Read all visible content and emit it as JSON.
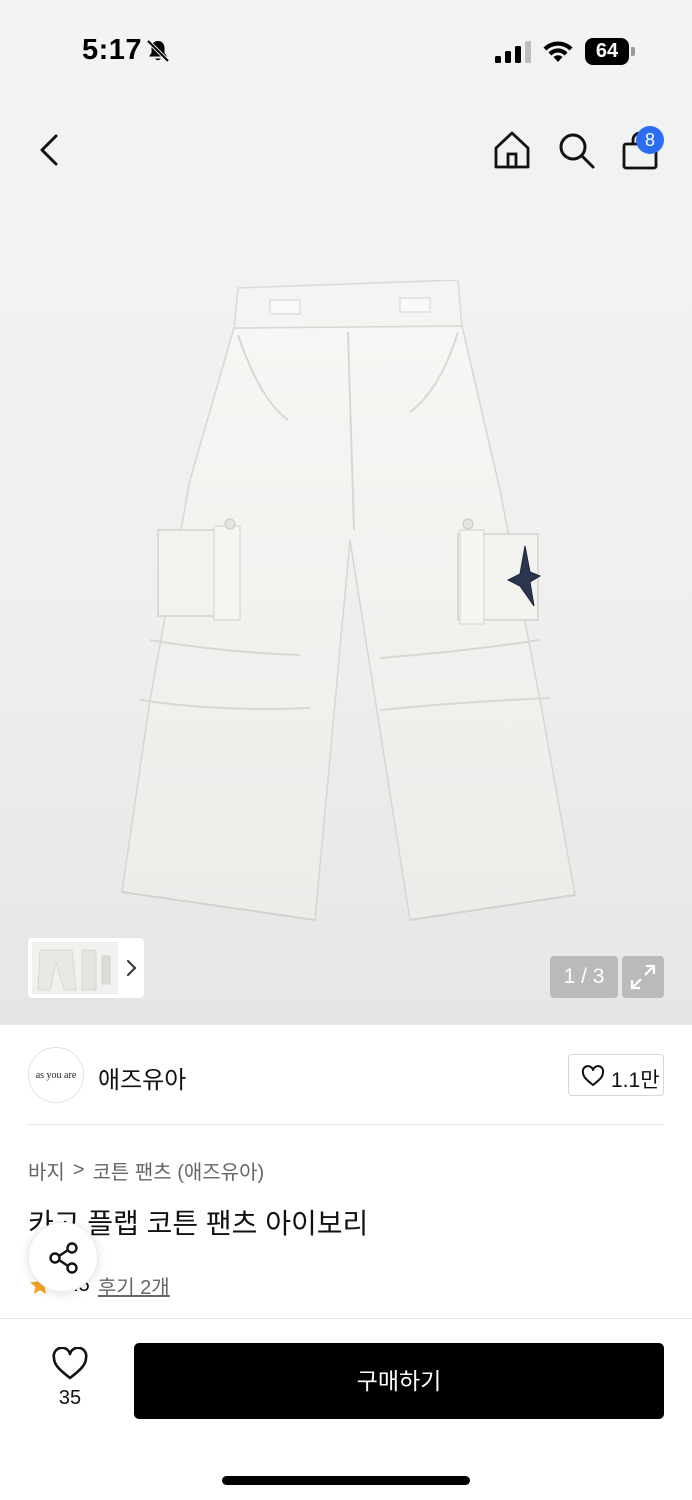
{
  "status_bar": {
    "time": "5:17",
    "battery": "64"
  },
  "nav": {
    "cart_count": "8"
  },
  "gallery": {
    "page_indicator": "1 / 3"
  },
  "brand": {
    "logo_text": "as you are",
    "name": "애즈유아",
    "like_count": "1.1만"
  },
  "breadcrumb": {
    "category": "바지",
    "separator": ">",
    "subcategory": "코튼 팬츠 (애즈유아)"
  },
  "product": {
    "title": "카고 플랩 코튼 팬츠 아이보리",
    "rating": "4.5",
    "review_link": "후기 2개"
  },
  "bottom_bar": {
    "wish_count": "35",
    "buy_label": "구매하기"
  },
  "colors": {
    "accent_badge": "#2b6ef2",
    "buy_button": "#000000",
    "star": "#f5a623"
  },
  "icons": [
    "back-arrow-icon",
    "home-icon",
    "search-icon",
    "shopping-bag-icon",
    "expand-icon",
    "heart-icon",
    "share-icon",
    "star-icon",
    "chevron-right-icon",
    "mute-bell-icon",
    "signal-icon",
    "wifi-icon"
  ]
}
